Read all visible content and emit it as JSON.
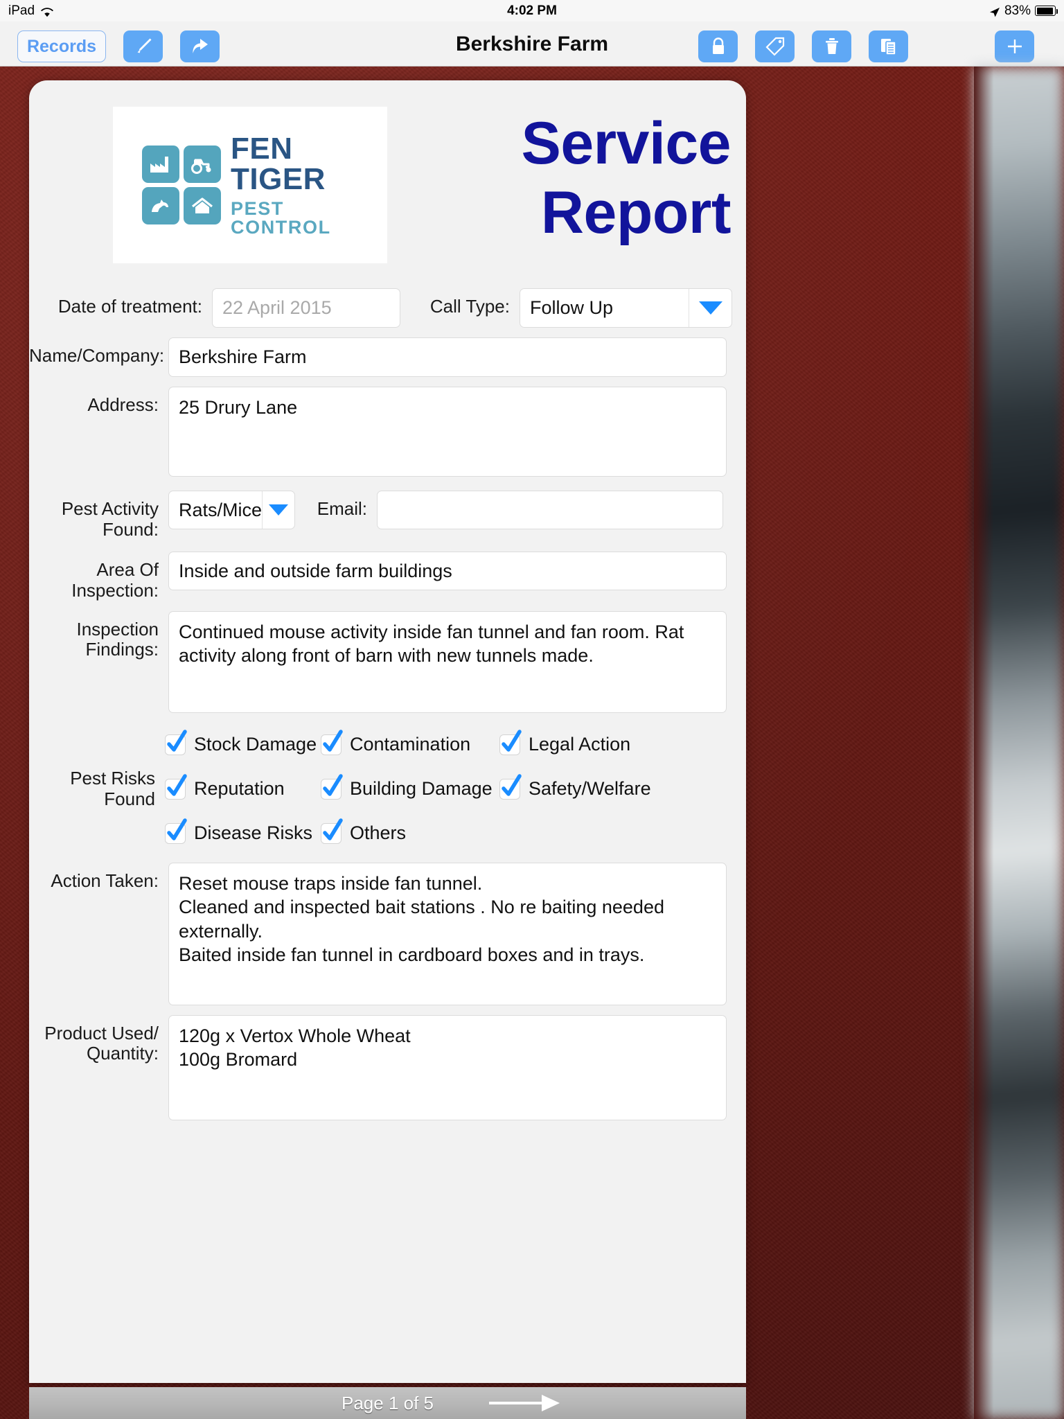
{
  "status_bar": {
    "device": "iPad",
    "wifi_icon": "wifi-icon",
    "time": "4:02 PM",
    "location_icon": "location-arrow-icon",
    "battery_percent": "83%",
    "battery_icon": "battery-icon"
  },
  "toolbar": {
    "back_label": "Records",
    "title": "Berkshire Farm",
    "buttons": [
      {
        "name": "edit-pen-icon"
      },
      {
        "name": "share-arrow-icon"
      },
      {
        "name": "lock-icon"
      },
      {
        "name": "tag-icon"
      },
      {
        "name": "trash-icon"
      },
      {
        "name": "duplicate-document-icon"
      },
      {
        "name": "add-plus-icon"
      }
    ]
  },
  "logo": {
    "line1": "FEN TIGER",
    "line2": "PEST CONTROL",
    "tiles": [
      "factory-icon",
      "tractor-icon",
      "horse-icon",
      "house-icon"
    ],
    "tile_color": "#54a5bd",
    "word_color": "#2a5584",
    "sub_color": "#5aa8c0"
  },
  "headline": {
    "line1": "Service",
    "line2": "Report",
    "color": "#12149b"
  },
  "form": {
    "date_label": "Date of treatment:",
    "date_value": "22 April 2015",
    "call_type_label": "Call Type:",
    "call_type_value": "Follow Up",
    "name_label": "Name/Company:",
    "name_value": "Berkshire Farm",
    "address_label": "Address:",
    "address_value": "25 Drury Lane",
    "pest_activity_label": "Pest Activity\nFound:",
    "pest_activity_value": "Rats/Mice",
    "email_label": "Email:",
    "email_value": "",
    "area_label": "Area Of\nInspection:",
    "area_value": "Inside and outside farm buildings",
    "findings_label": "Inspection\nFindings:",
    "findings_value": "Continued mouse activity inside fan tunnel and fan room. Rat activity along front of barn with new tunnels made.",
    "risks_label": "Pest Risks\nFound",
    "risks": [
      {
        "label": "Stock Damage",
        "checked": true
      },
      {
        "label": "Contamination",
        "checked": true
      },
      {
        "label": "Legal Action",
        "checked": true
      },
      {
        "label": "Reputation",
        "checked": true
      },
      {
        "label": "Building Damage",
        "checked": true
      },
      {
        "label": "Safety/Welfare",
        "checked": true
      },
      {
        "label": "Disease Risks",
        "checked": true
      },
      {
        "label": "Others",
        "checked": true
      }
    ],
    "action_label": "Action Taken:",
    "action_value": "Reset mouse traps inside fan tunnel.\nCleaned and inspected bait stations . No re baiting needed externally.\nBaited inside fan tunnel in cardboard boxes and in trays.",
    "product_label": "Product Used/\nQuantity:",
    "product_value": "120g x Vertox Whole Wheat\n100g Bromard"
  },
  "footer": {
    "page_text": "Page 1 of 5",
    "next_icon": "next-arrow-icon"
  },
  "colors": {
    "accent_blue": "#5fa8f5",
    "check_blue": "#1a8cff",
    "desk_red": "#6e1b15"
  }
}
